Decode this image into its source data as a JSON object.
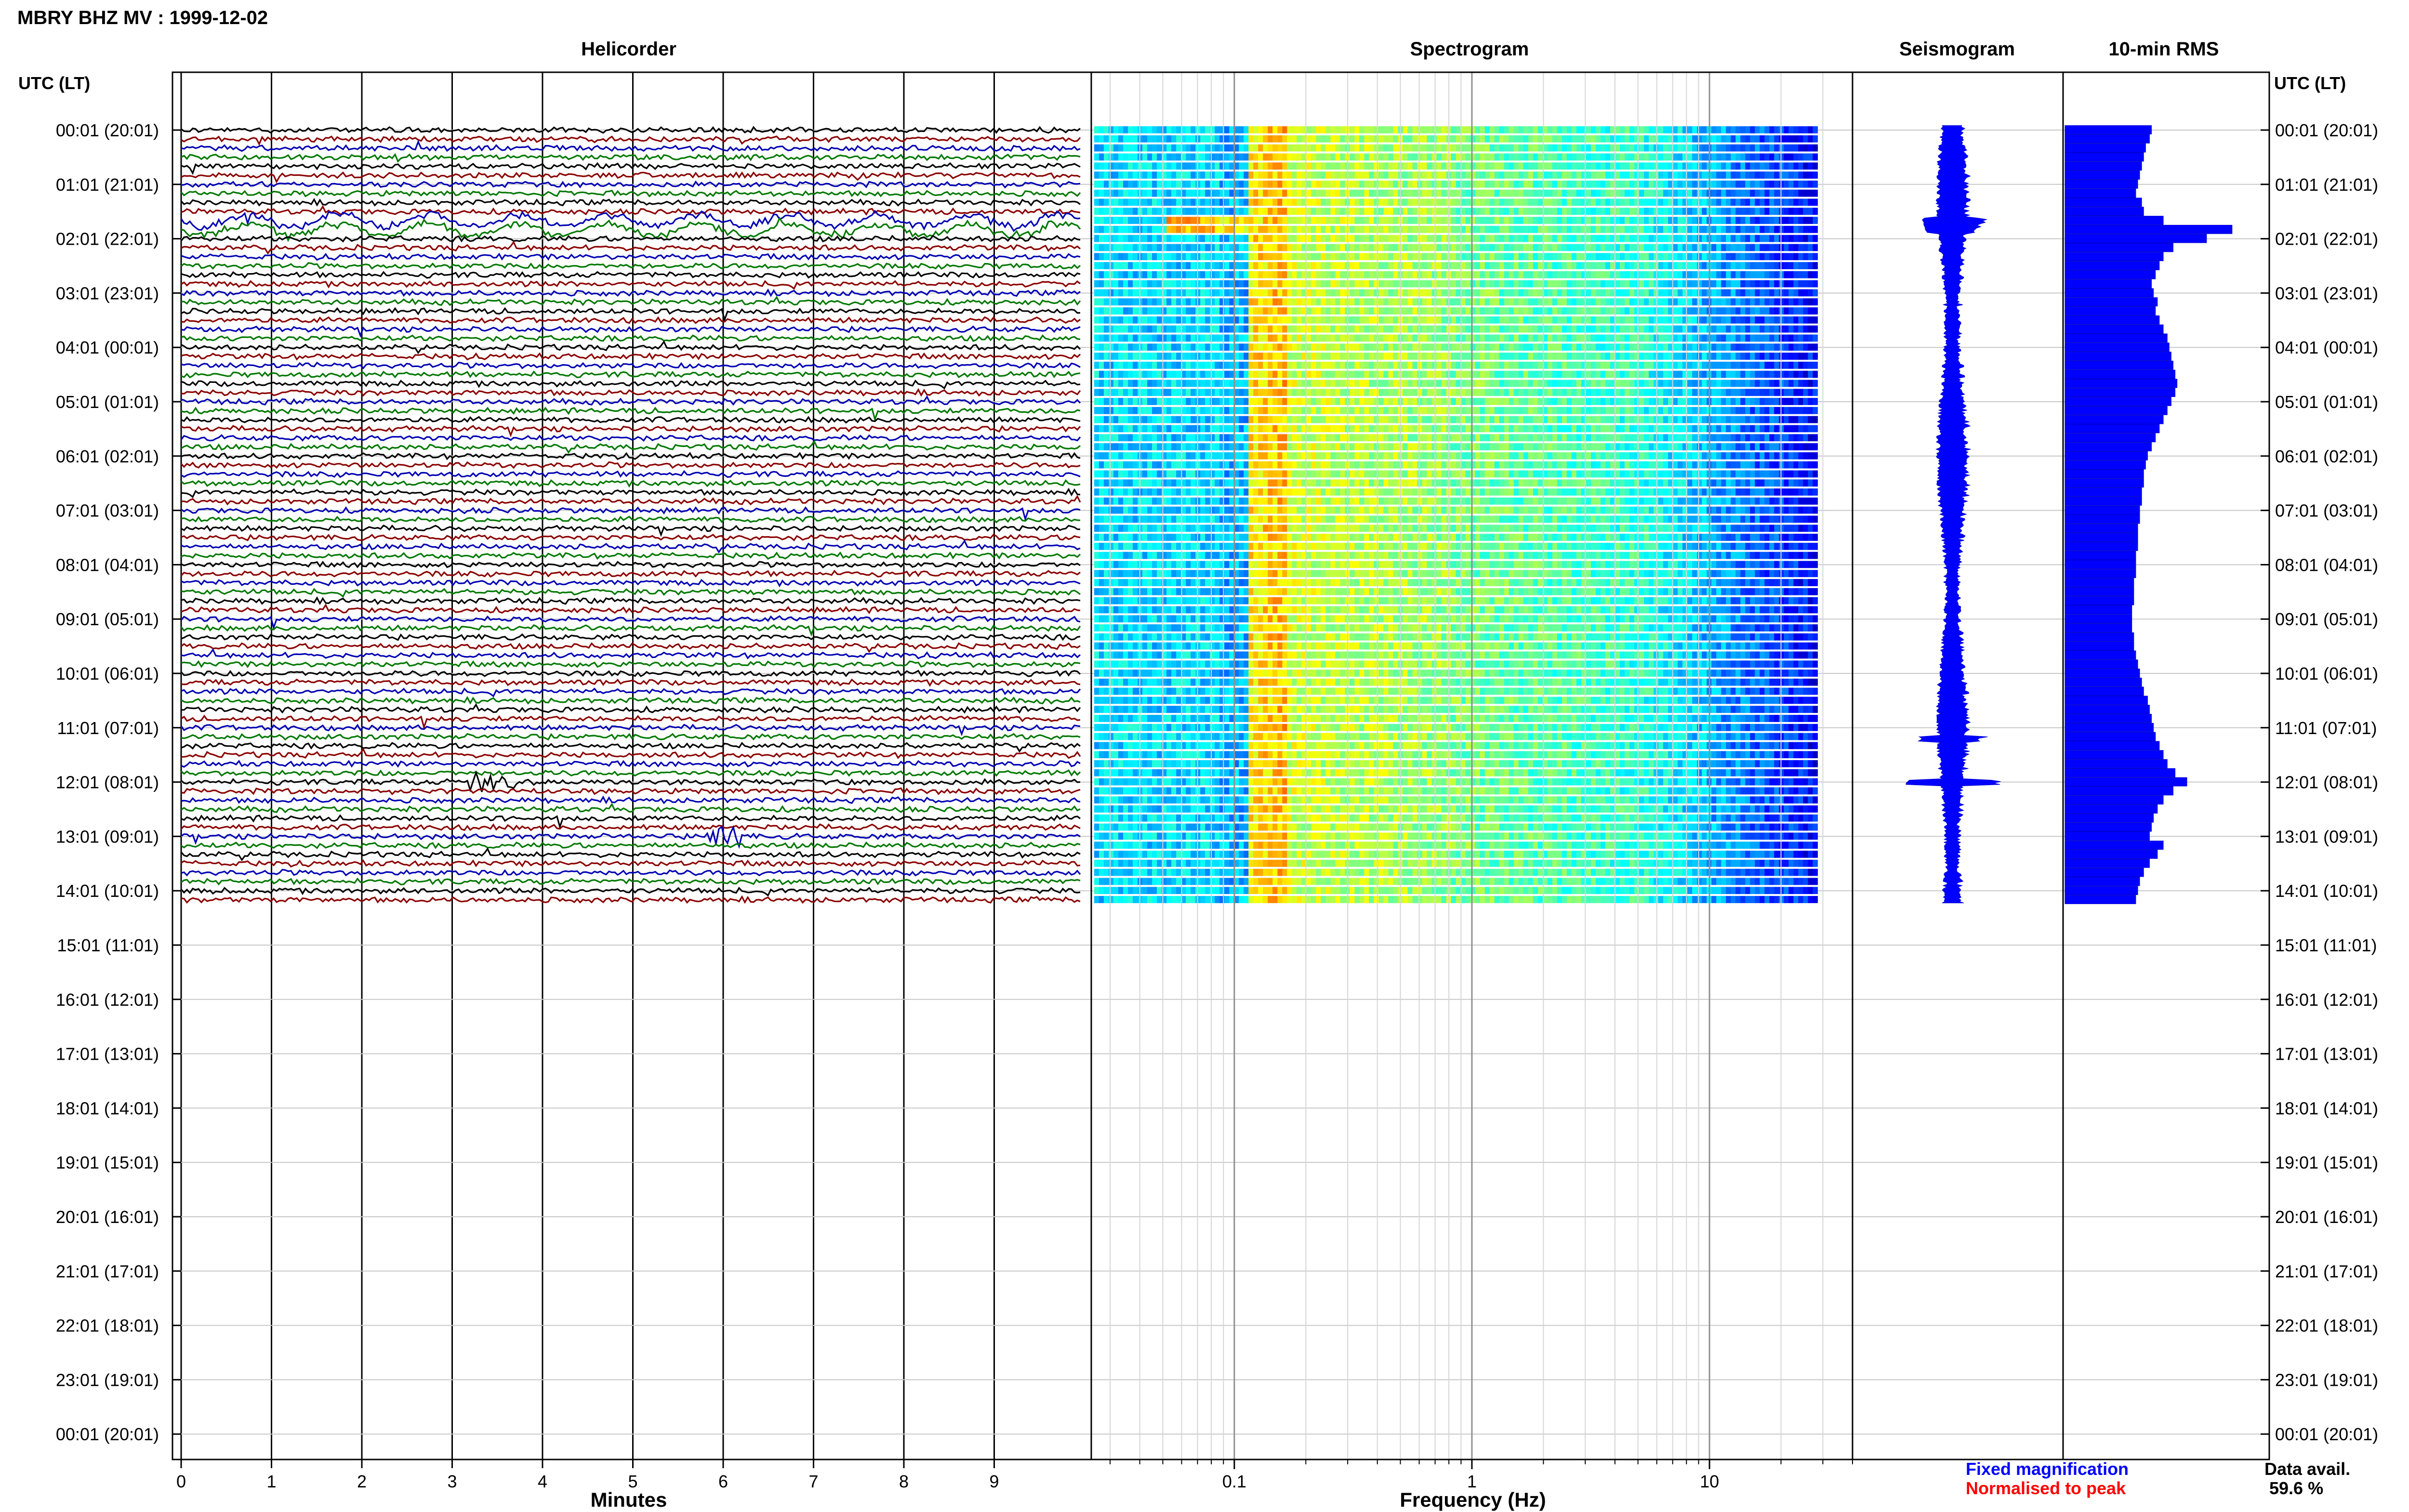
{
  "title": "MBRY BHZ MV : 1999-12-02",
  "time_axis_label": "UTC (LT)",
  "chart_data": [
    {
      "type": "line",
      "name": "helicorder",
      "title": "Helicorder",
      "xlabel": "Minutes",
      "xlim": [
        0,
        10
      ],
      "x_ticks": [
        "0",
        "1",
        "2",
        "3",
        "4",
        "5",
        "6",
        "7",
        "8",
        "9"
      ],
      "y_tick_labels": [
        "00:01 (20:01)",
        "01:01 (21:01)",
        "02:01 (22:01)",
        "03:01 (23:01)",
        "04:01 (00:01)",
        "05:01 (01:01)",
        "06:01 (02:01)",
        "07:01 (03:01)",
        "08:01 (04:01)",
        "09:01 (05:01)",
        "10:01 (06:01)",
        "11:01 (07:01)",
        "12:01 (08:01)",
        "13:01 (09:01)",
        "14:01 (10:01)",
        "15:01 (11:01)",
        "16:01 (12:01)",
        "17:01 (13:01)",
        "18:01 (14:01)",
        "19:01 (15:01)",
        "20:01 (16:01)",
        "21:01 (17:01)",
        "22:01 (18:01)",
        "23:01 (19:01)",
        "00:01 (20:01)"
      ],
      "trace_colors": [
        "#000000",
        "#8b0000",
        "#0000b4",
        "#007800"
      ],
      "traces_per_hour": 6,
      "recorded_traces": 86,
      "events": [
        {
          "hour": 1.75,
          "minute_start": 0,
          "minute_end": 10,
          "color": "#8b0000"
        },
        {
          "hour": 12.0,
          "minute_start": 3.2,
          "minute_end": 3.7,
          "color": "#000000"
        },
        {
          "hour": 13.0,
          "minute_start": 5.8,
          "minute_end": 6.2,
          "color": "#0000b4"
        }
      ]
    },
    {
      "type": "heatmap",
      "name": "spectrogram",
      "title": "Spectrogram",
      "xlabel": "Frequency (Hz)",
      "x_scale": "log",
      "xlim": [
        0.025,
        40
      ],
      "x_ticks": [
        "0.1",
        "1",
        "10"
      ],
      "recorded_traces": 86
    },
    {
      "type": "line",
      "name": "seismogram",
      "title": "Seismogram",
      "recorded_traces": 86
    },
    {
      "type": "bar",
      "name": "rms",
      "title": "10-min RMS",
      "orientation": "horizontal",
      "values": [
        0.44,
        0.43,
        0.41,
        0.4,
        0.39,
        0.38,
        0.37,
        0.36,
        0.39,
        0.4,
        0.5,
        0.85,
        0.72,
        0.55,
        0.5,
        0.48,
        0.46,
        0.44,
        0.45,
        0.47,
        0.46,
        0.48,
        0.5,
        0.52,
        0.53,
        0.54,
        0.55,
        0.56,
        0.57,
        0.56,
        0.54,
        0.52,
        0.5,
        0.48,
        0.46,
        0.44,
        0.42,
        0.41,
        0.4,
        0.4,
        0.39,
        0.39,
        0.38,
        0.38,
        0.37,
        0.37,
        0.37,
        0.36,
        0.36,
        0.36,
        0.35,
        0.35,
        0.35,
        0.34,
        0.34,
        0.34,
        0.35,
        0.35,
        0.36,
        0.37,
        0.38,
        0.39,
        0.4,
        0.42,
        0.43,
        0.44,
        0.45,
        0.46,
        0.48,
        0.5,
        0.52,
        0.56,
        0.62,
        0.55,
        0.5,
        0.47,
        0.45,
        0.44,
        0.43,
        0.5,
        0.47,
        0.43,
        0.4,
        0.38,
        0.37,
        0.36
      ]
    }
  ],
  "legend": {
    "fixed_label": "Fixed magnification",
    "fixed_color": "#0000ff",
    "normalised_label": "Normalised to peak",
    "normalised_color": "#ff0000"
  },
  "availability": {
    "label": "Data avail.",
    "value": "59.6 %"
  }
}
